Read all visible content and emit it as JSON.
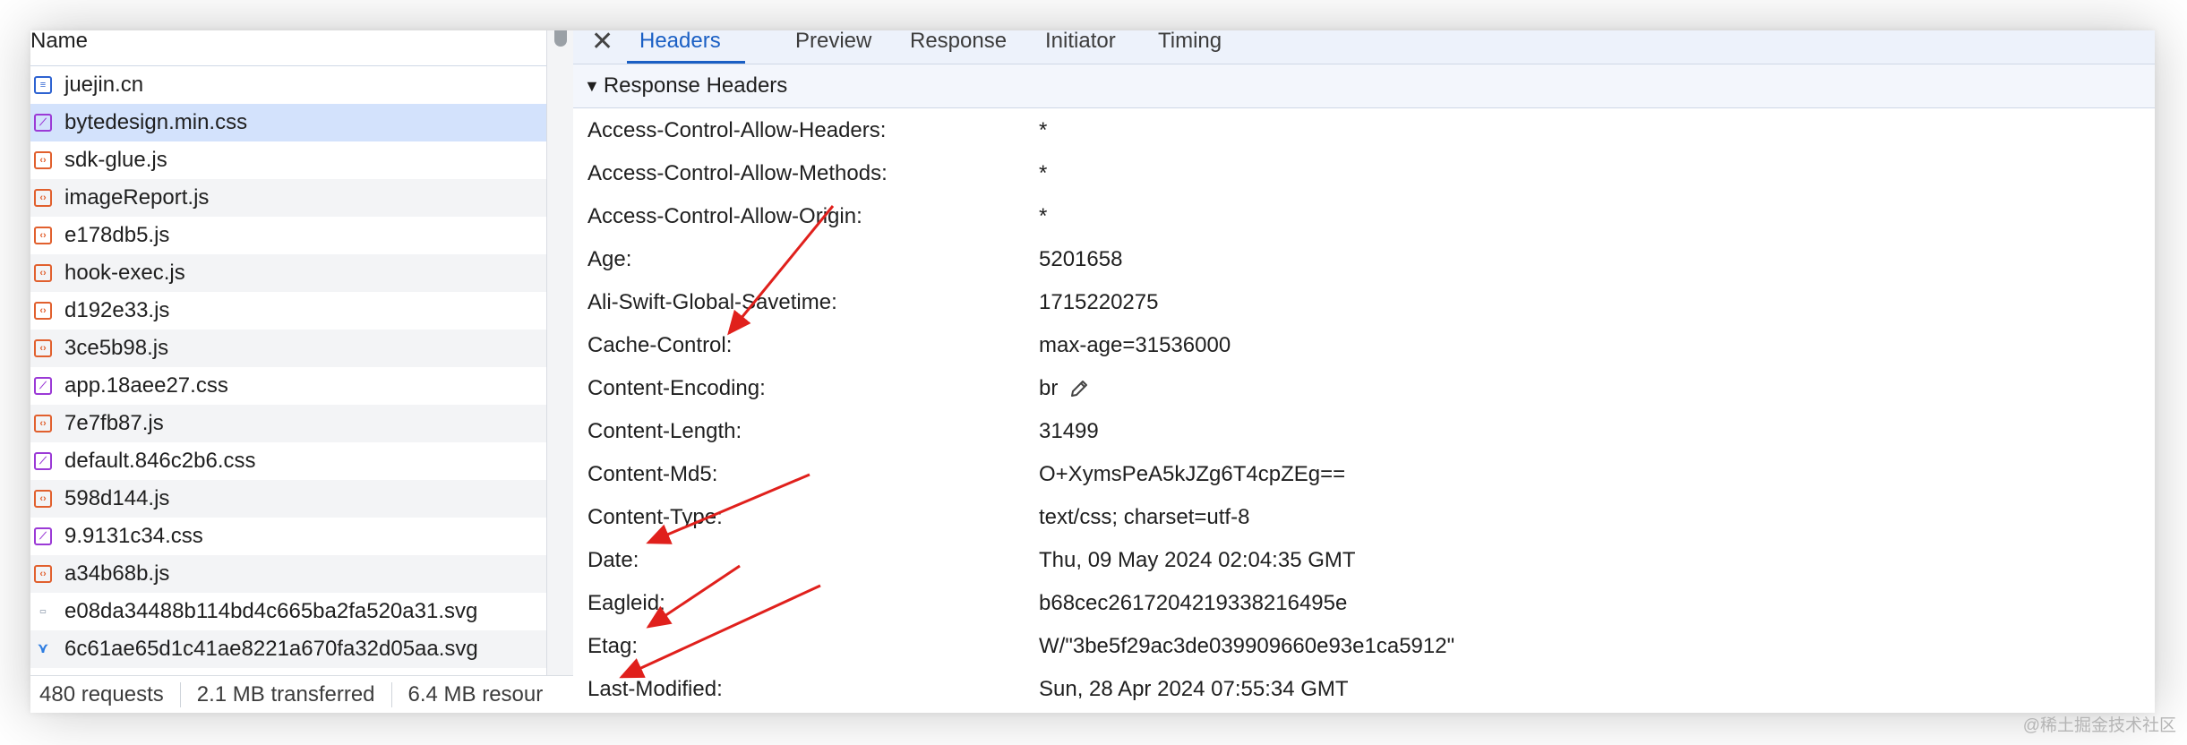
{
  "list": {
    "column_name": "Name",
    "requests": [
      {
        "name": "juejin.cn",
        "type": "doc"
      },
      {
        "name": "bytedesign.min.css",
        "type": "css",
        "selected": true
      },
      {
        "name": "sdk-glue.js",
        "type": "js"
      },
      {
        "name": "imageReport.js",
        "type": "js"
      },
      {
        "name": "e178db5.js",
        "type": "js"
      },
      {
        "name": "hook-exec.js",
        "type": "js"
      },
      {
        "name": "d192e33.js",
        "type": "js"
      },
      {
        "name": "3ce5b98.js",
        "type": "js"
      },
      {
        "name": "app.18aee27.css",
        "type": "css"
      },
      {
        "name": "7e7fb87.js",
        "type": "js"
      },
      {
        "name": "default.846c2b6.css",
        "type": "css"
      },
      {
        "name": "598d144.js",
        "type": "js"
      },
      {
        "name": "9.9131c34.css",
        "type": "css"
      },
      {
        "name": "a34b68b.js",
        "type": "js"
      },
      {
        "name": "e08da34488b114bd4c665ba2fa520a31.svg",
        "type": "svg-a"
      },
      {
        "name": "6c61ae65d1c41ae8221a670fa32d05aa.svg",
        "type": "svg-b"
      }
    ]
  },
  "footer": {
    "requests": "480 requests",
    "transferred": "2.1 MB transferred",
    "resources": "6.4 MB resour"
  },
  "tabs": [
    {
      "label": "Headers",
      "active": true
    },
    {
      "label": "Preview"
    },
    {
      "label": "Response"
    },
    {
      "label": "Initiator"
    },
    {
      "label": "Timing"
    }
  ],
  "section": {
    "title": "Response Headers"
  },
  "headers": [
    {
      "key": "Access-Control-Allow-Headers:",
      "value": "*"
    },
    {
      "key": "Access-Control-Allow-Methods:",
      "value": "*"
    },
    {
      "key": "Access-Control-Allow-Origin:",
      "value": "*"
    },
    {
      "key": "Age:",
      "value": "5201658"
    },
    {
      "key": "Ali-Swift-Global-Savetime:",
      "value": "1715220275"
    },
    {
      "key": "Cache-Control:",
      "value": "max-age=31536000"
    },
    {
      "key": "Content-Encoding:",
      "value": "br",
      "icon": "pencil-icon"
    },
    {
      "key": "Content-Length:",
      "value": "31499"
    },
    {
      "key": "Content-Md5:",
      "value": "O+XymsPeA5kJZg6T4cpZEg=="
    },
    {
      "key": "Content-Type:",
      "value": "text/css; charset=utf-8"
    },
    {
      "key": "Date:",
      "value": "Thu, 09 May 2024 02:04:35 GMT"
    },
    {
      "key": "Eagleid:",
      "value": "b68cec2617204219338216495e"
    },
    {
      "key": "Etag:",
      "value": "W/\"3be5f29ac3de039909660e93e1ca5912\""
    },
    {
      "key": "Last-Modified:",
      "value": "Sun, 28 Apr 2024 07:55:34 GMT"
    }
  ],
  "watermark": "@稀土掘金技术社区",
  "colors": {
    "accent": "#1a5fc4",
    "selected_row": "#d3e2fc",
    "annotation_arrow": "#e0201c"
  }
}
